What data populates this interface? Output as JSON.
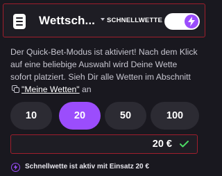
{
  "header": {
    "title": "Wettsch...",
    "mode_label": "SCHNELLWETTE",
    "toggle_state": "on",
    "icons": {
      "menu": "document-icon",
      "dropdown": "caret-down-icon",
      "toggle": "lightning-icon"
    }
  },
  "info": {
    "text": "Der Quick-Bet-Modus ist aktiviert! Nach dem Klick auf eine beliebige Auswahl wird Deine Wette sofort platziert. Sieh Dir alle Wetten im Abschnitt",
    "link_text": "\"Meine Wetten\"",
    "suffix": "an",
    "link_icon": "copy-icon"
  },
  "amounts": {
    "options": [
      "10",
      "20",
      "50",
      "100"
    ],
    "selected": "20"
  },
  "stake": {
    "value": "20 €",
    "confirm_icon": "check-icon"
  },
  "status": {
    "text": "Schnellwette ist aktiv mit Einsatz 20 €",
    "icon": "lightning-icon"
  },
  "colors": {
    "accent": "#9b4dfc",
    "border": "#a01e2c",
    "background": "#19181f",
    "confirm": "#4cd964"
  }
}
